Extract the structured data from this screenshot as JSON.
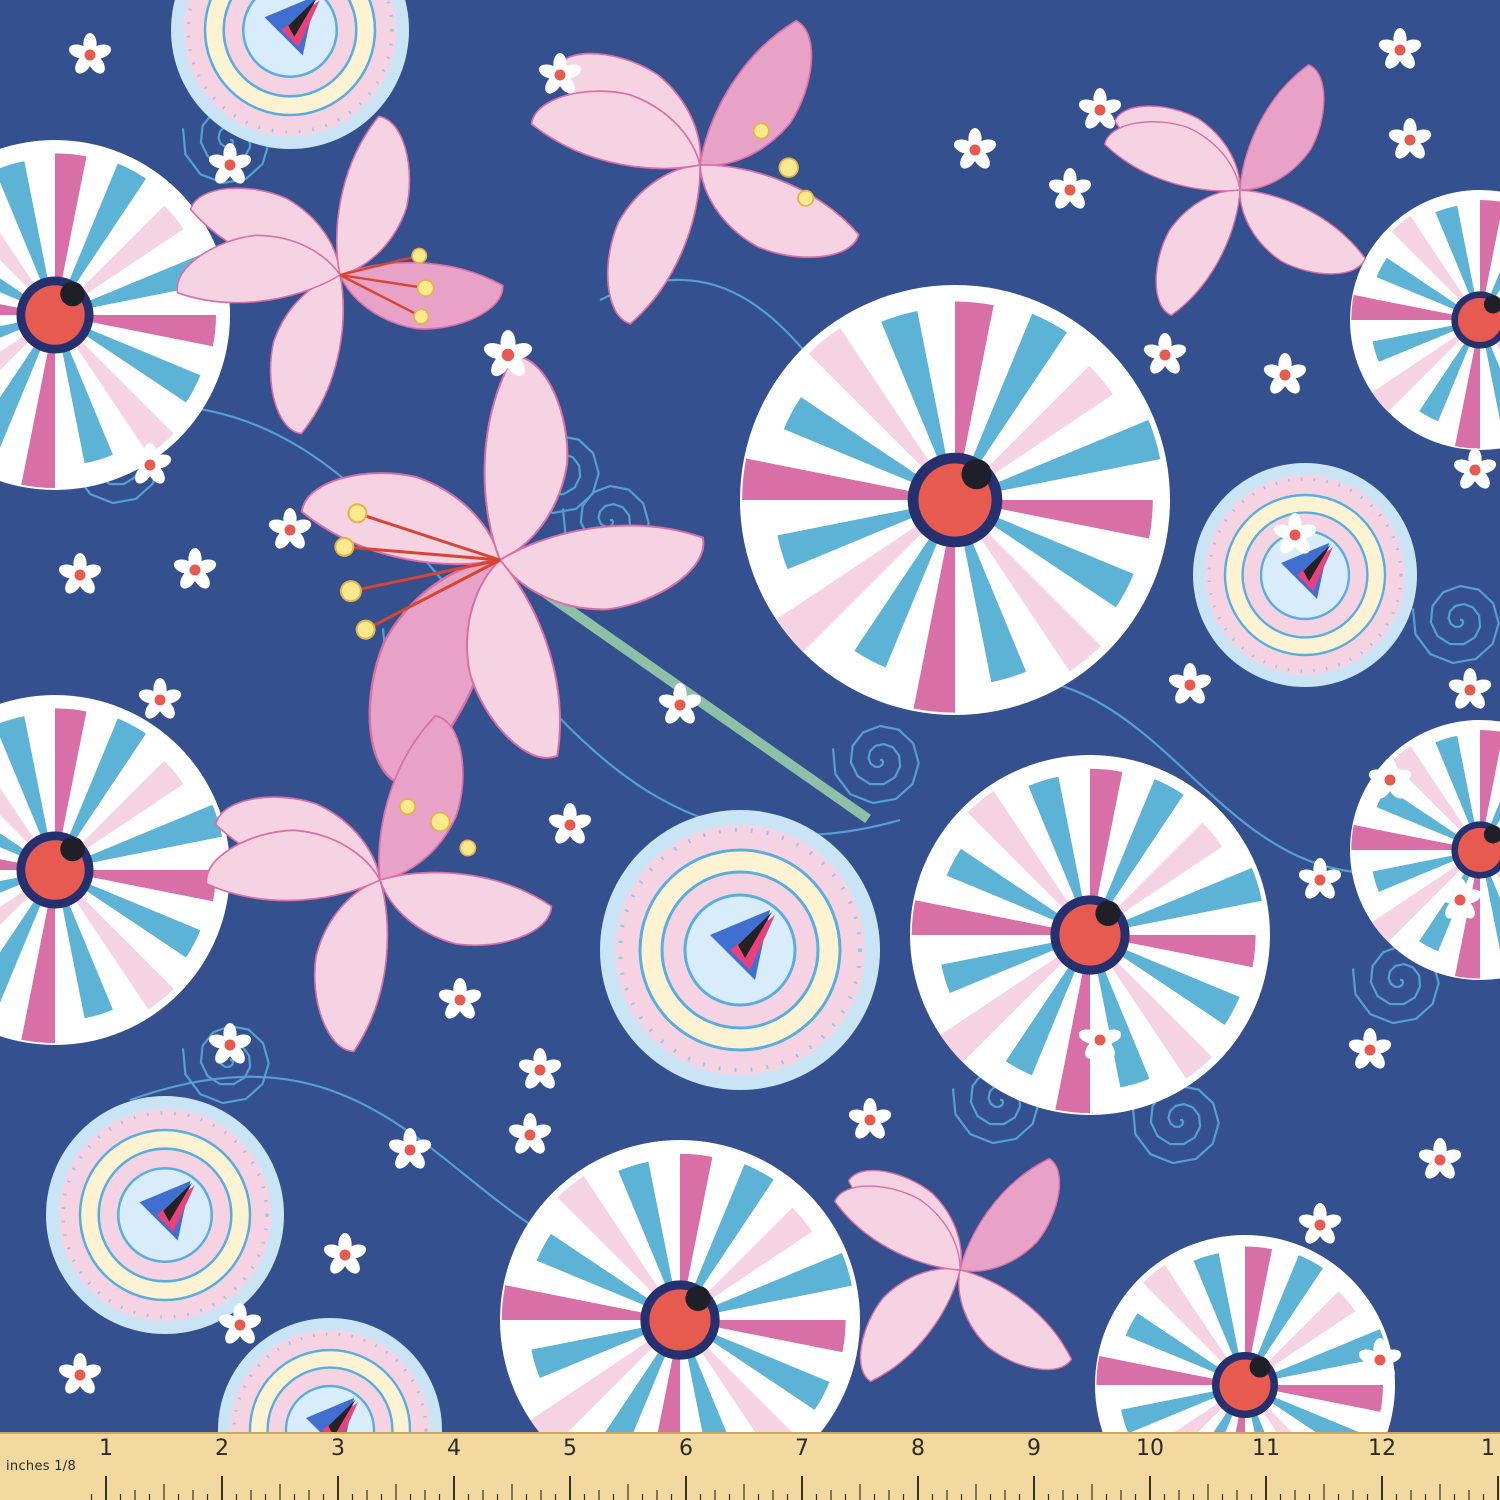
{
  "image": {
    "subject": "printed floral fabric swatch with measuring ruler",
    "colors": {
      "background_navy": "#34508f",
      "swirl_blue": "#5aaede",
      "pink_light": "#f6d3e3",
      "pink_mid": "#e8a2c8",
      "pink_deep": "#d86fa6",
      "teal": "#5db3d6",
      "white": "#ffffff",
      "coral": "#e65a50",
      "yellow": "#fbe98e",
      "ruler_wood": "#f1d9a0"
    }
  },
  "ruler": {
    "unit_label": "inches 1/8",
    "numbers": [
      "1",
      "2",
      "3",
      "4",
      "5",
      "6",
      "7",
      "8",
      "9",
      "10",
      "11",
      "12",
      "1"
    ]
  }
}
